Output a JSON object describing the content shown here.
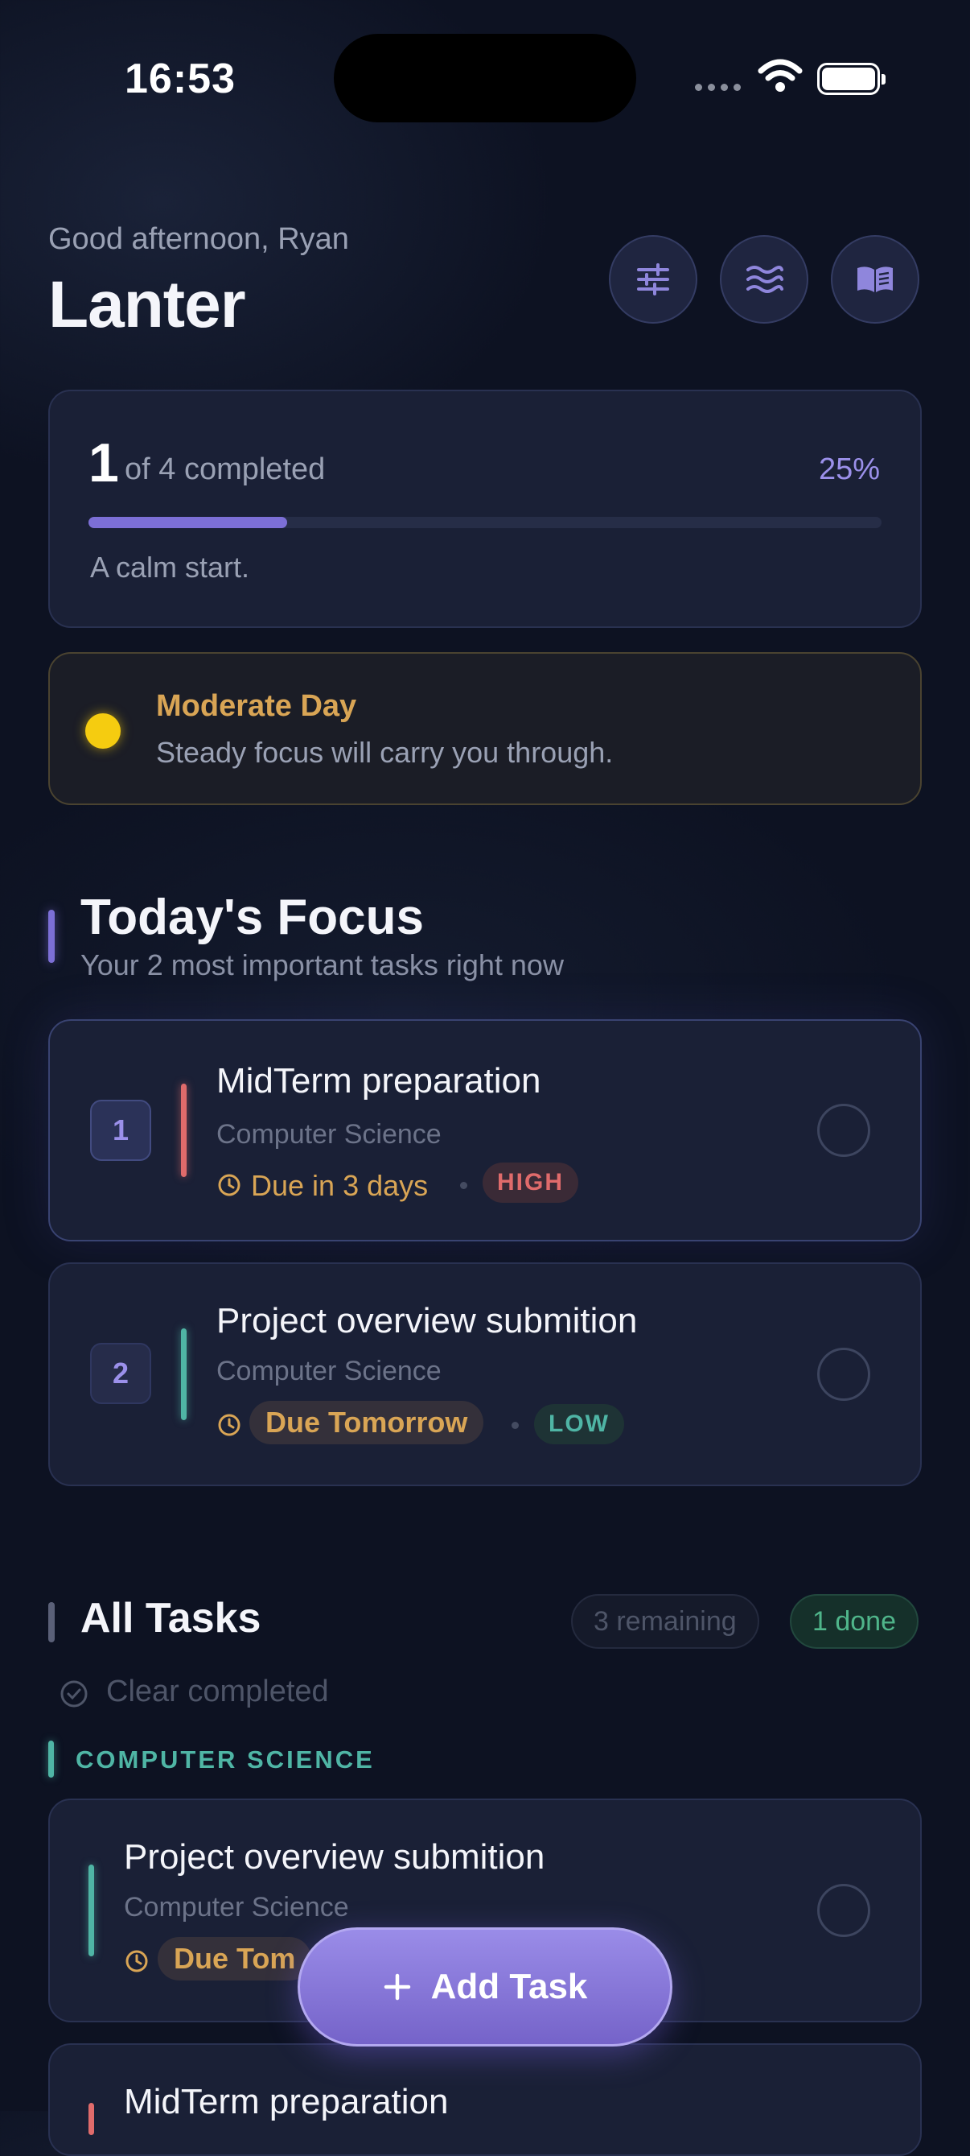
{
  "status": {
    "time": "16:53"
  },
  "header": {
    "greeting": "Good afternoon, Ryan",
    "title": "Lanter",
    "buttons": [
      "sliders-icon",
      "waves-icon",
      "book-icon"
    ]
  },
  "progress": {
    "completed": "1",
    "of_text": "of 4 completed",
    "percent_text": "25%",
    "fraction": 0.25,
    "message": "A calm start."
  },
  "mood": {
    "title": "Moderate Day",
    "subtitle": "Steady focus will carry you through.",
    "color": "#f5cc10"
  },
  "focus": {
    "title": "Today's Focus",
    "subtitle": "Your 2 most important tasks right now",
    "tasks": [
      {
        "rank": "1",
        "title": "MidTerm preparation",
        "course": "Computer Science",
        "due": "Due in 3 days",
        "priority": "HIGH",
        "priority_color": "#e06b6b"
      },
      {
        "rank": "2",
        "title": "Project overview submition",
        "course": "Computer Science",
        "due": "Due Tomorrow",
        "priority": "LOW",
        "priority_color": "#4fb5a5"
      }
    ]
  },
  "all_tasks": {
    "title": "All Tasks",
    "remaining": "3 remaining",
    "done": "1 done",
    "clear": "Clear completed",
    "group": "COMPUTER SCIENCE",
    "items": [
      {
        "title": "Project overview submition",
        "course": "Computer Science",
        "due": "Due Tom"
      },
      {
        "title": "MidTerm preparation"
      }
    ]
  },
  "fab": {
    "label": "Add Task"
  }
}
